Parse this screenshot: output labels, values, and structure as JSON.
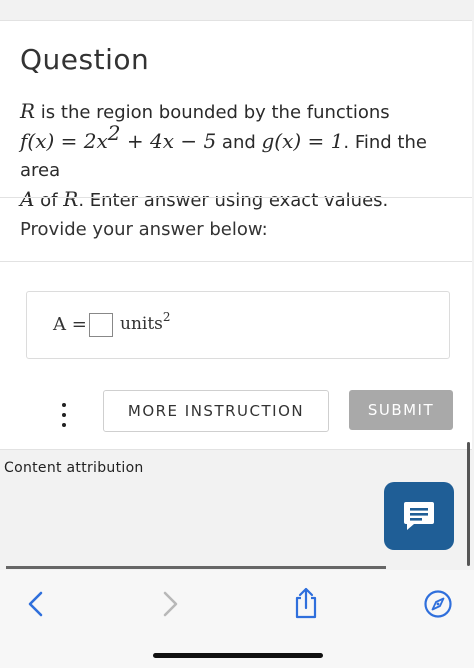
{
  "question": {
    "title": "Question",
    "line1": {
      "var": "R",
      "text": " is the region bounded by the functions"
    },
    "line2": {
      "f_lhs": "f(x) = 2x",
      "f_exp": "2",
      "f_rhs": " + 4x − 5",
      "and": " and ",
      "g": "g(x) = 1",
      "rest": ". Find the area"
    },
    "line3": {
      "var_a": "A",
      "of": " of ",
      "var_r": "R",
      "rest": ". Enter answer using exact values."
    }
  },
  "prompt": {
    "text": "Provide your answer below:"
  },
  "answer": {
    "label": "A =",
    "value": "",
    "unit": "units",
    "unit_exp": "2"
  },
  "actions": {
    "more_label": "MORE INSTRUCTION",
    "submit_label": "SUBMIT"
  },
  "footer": {
    "attribution": "Content attribution"
  },
  "icons": {
    "kebab": "more-vertical-icon",
    "chat": "chat-icon",
    "back": "chevron-left-icon",
    "forward": "chevron-right-icon",
    "share": "share-icon",
    "compass": "compass-icon"
  },
  "colors": {
    "chat_bg": "#1f5e96",
    "submit_bg": "#a9a9a9",
    "safari_blue": "#2f6fdc",
    "disabled_gray": "#b8b8b8"
  }
}
